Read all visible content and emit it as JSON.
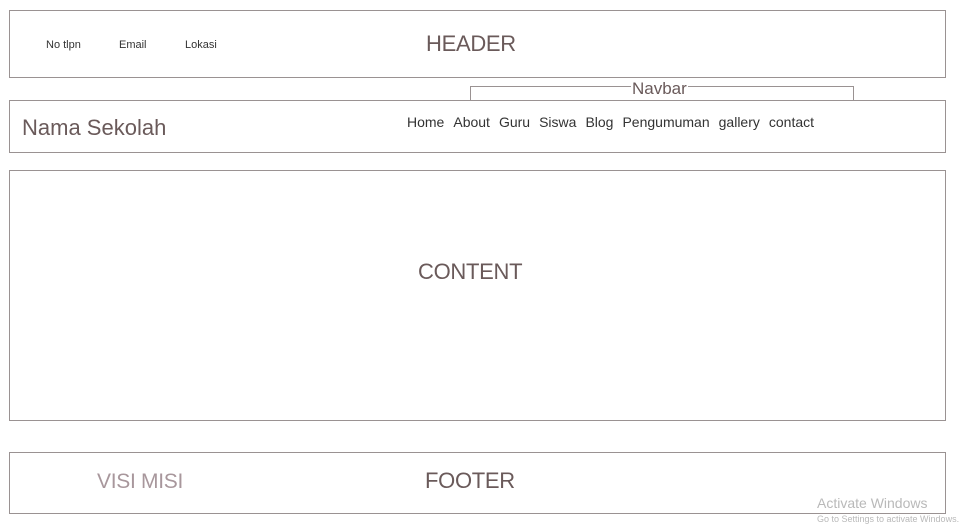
{
  "header": {
    "title": "HEADER",
    "contact": {
      "phone": "No tlpn",
      "email": "Email",
      "location": "Lokasi"
    }
  },
  "navbar": {
    "annotation": "Navbar",
    "school_name": "Nama Sekolah",
    "items": [
      "Home",
      "About",
      "Guru",
      "Siswa",
      "Blog",
      "Pengumuman",
      "gallery",
      "contact"
    ]
  },
  "content": {
    "title": "CONTENT"
  },
  "footer": {
    "title": "FOOTER",
    "visi_misi": "VISI MISI"
  },
  "watermark": {
    "title": "Activate Windows",
    "subtitle": "Go to Settings to activate Windows."
  }
}
